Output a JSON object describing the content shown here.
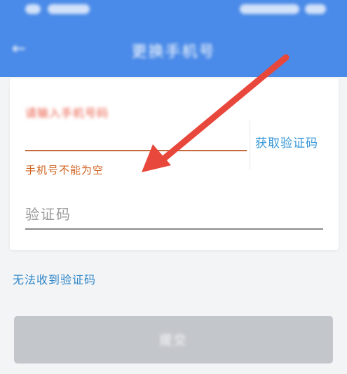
{
  "status_bar": {
    "time": "",
    "battery": ""
  },
  "header": {
    "title": "更换手机号",
    "back_icon": "back-arrow-icon"
  },
  "form": {
    "phone_value": "请输入手机号码",
    "get_code_label": "获取验证码",
    "error_message": "手机号不能为空",
    "code_placeholder": "验证码"
  },
  "links": {
    "no_code_label": "无法收到验证码"
  },
  "actions": {
    "submit_label": "提交"
  },
  "annotation": {
    "arrow_color": "#e8473b",
    "arrow_icon": "red-arrow-icon"
  },
  "colors": {
    "header_bg": "#4a8ae8",
    "accent_link": "#3a9ad9",
    "error": "#d0611d",
    "button_disabled": "#c3c6cb"
  }
}
